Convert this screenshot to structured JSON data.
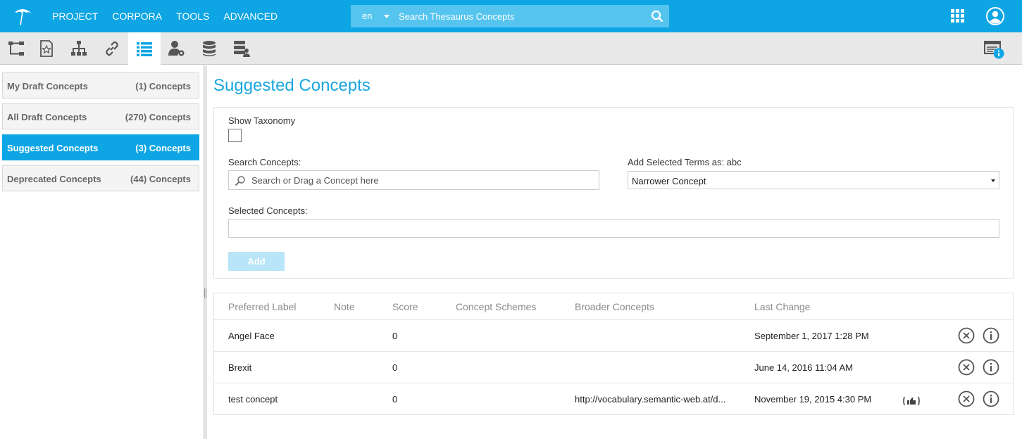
{
  "topbar": {
    "nav": [
      "PROJECT",
      "CORPORA",
      "TOOLS",
      "ADVANCED"
    ],
    "language": "en",
    "search_placeholder": "Search Thesaurus Concepts"
  },
  "toolbar": {
    "tools": [
      "hierarchy-tree-icon",
      "star-document-icon",
      "org-chart-icon",
      "link-icon",
      "list-icon",
      "user-settings-icon",
      "database-icon",
      "server-user-icon"
    ],
    "active_tool": "list-icon"
  },
  "sidebar": {
    "items": [
      {
        "label": "My Draft Concepts",
        "count": "(1) Concepts"
      },
      {
        "label": "All Draft Concepts",
        "count": "(270) Concepts"
      },
      {
        "label": "Suggested Concepts",
        "count": "(3) Concepts"
      },
      {
        "label": "Deprecated Concepts",
        "count": "(44) Concepts"
      }
    ],
    "active_index": 2
  },
  "main": {
    "title": "Suggested Concepts",
    "show_taxonomy_label": "Show Taxonomy",
    "search_label": "Search Concepts:",
    "search_placeholder": "Search or Drag a Concept here",
    "add_as_label": "Add Selected Terms as: abc",
    "add_as_value": "Narrower Concept",
    "selected_label": "Selected Concepts:",
    "add_button": "Add"
  },
  "table": {
    "columns": [
      "Preferred Label",
      "Note",
      "Score",
      "Concept Schemes",
      "Broader Concepts",
      "Last Change"
    ],
    "rows": [
      {
        "label": "Angel Face",
        "note": "",
        "score": "0",
        "schemes": "",
        "broader": "",
        "last_change": "September 1, 2017 1:28 PM",
        "thumbs": false
      },
      {
        "label": "Brexit",
        "note": "",
        "score": "0",
        "schemes": "",
        "broader": "",
        "last_change": "June 14, 2016 11:04 AM",
        "thumbs": false
      },
      {
        "label": "test concept",
        "note": "",
        "score": "0",
        "schemes": "",
        "broader": "http://vocabulary.semantic-web.at/d...",
        "last_change": "November 19, 2015 4:30 PM",
        "thumbs": true
      }
    ]
  },
  "colors": {
    "brand": "#0ea5e4",
    "title": "#19a6de"
  }
}
